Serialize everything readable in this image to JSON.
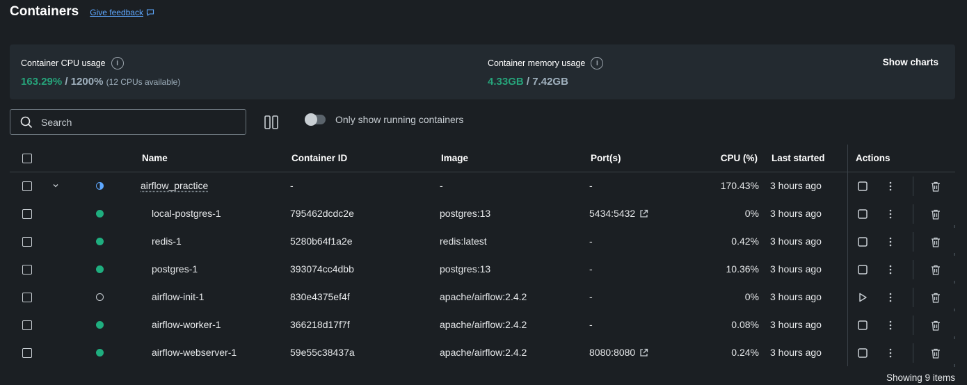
{
  "header": {
    "title": "Containers",
    "feedback": "Give feedback"
  },
  "stats": {
    "cpu": {
      "label": "Container CPU usage",
      "used": "163.29%",
      "separator": " / ",
      "total": "1200%",
      "note": "(12 CPUs available)"
    },
    "memory": {
      "label": "Container memory usage",
      "used": "4.33GB",
      "separator": " / ",
      "total": "7.42GB"
    },
    "show_charts": "Show charts"
  },
  "toolbar": {
    "search_placeholder": "Search",
    "toggle_label": "Only show running containers"
  },
  "table": {
    "columns": {
      "name": "Name",
      "id": "Container ID",
      "image": "Image",
      "ports": "Port(s)",
      "cpu": "CPU (%)",
      "last_started": "Last started",
      "actions": "Actions"
    },
    "rows": [
      {
        "name": "airflow_practice",
        "id": "-",
        "image": "-",
        "ports": "-",
        "cpu": "170.43%",
        "last_started": "3 hours ago"
      },
      {
        "name": "local-postgres-1",
        "id": "795462dcdc2e",
        "image": "postgres:13",
        "ports": "5434:5432",
        "cpu": "0%",
        "last_started": "3 hours ago"
      },
      {
        "name": "redis-1",
        "id": "5280b64f1a2e",
        "image": "redis:latest",
        "ports": "-",
        "cpu": "0.42%",
        "last_started": "3 hours ago"
      },
      {
        "name": "postgres-1",
        "id": "393074cc4dbb",
        "image": "postgres:13",
        "ports": "-",
        "cpu": "10.36%",
        "last_started": "3 hours ago"
      },
      {
        "name": "airflow-init-1",
        "id": "830e4375ef4f",
        "image": "apache/airflow:2.4.2",
        "ports": "-",
        "cpu": "0%",
        "last_started": "3 hours ago"
      },
      {
        "name": "airflow-worker-1",
        "id": "366218d17f7f",
        "image": "apache/airflow:2.4.2",
        "ports": "-",
        "cpu": "0.08%",
        "last_started": "3 hours ago"
      },
      {
        "name": "airflow-webserver-1",
        "id": "59e55c38437a",
        "image": "apache/airflow:2.4.2",
        "ports": "8080:8080",
        "cpu": "0.24%",
        "last_started": "3 hours ago"
      }
    ]
  },
  "footer": {
    "count": "Showing 9 items"
  },
  "colors": {
    "accent_green": "#1fae7f",
    "link_blue": "#5ea8ff",
    "background": "#1b1f23"
  }
}
